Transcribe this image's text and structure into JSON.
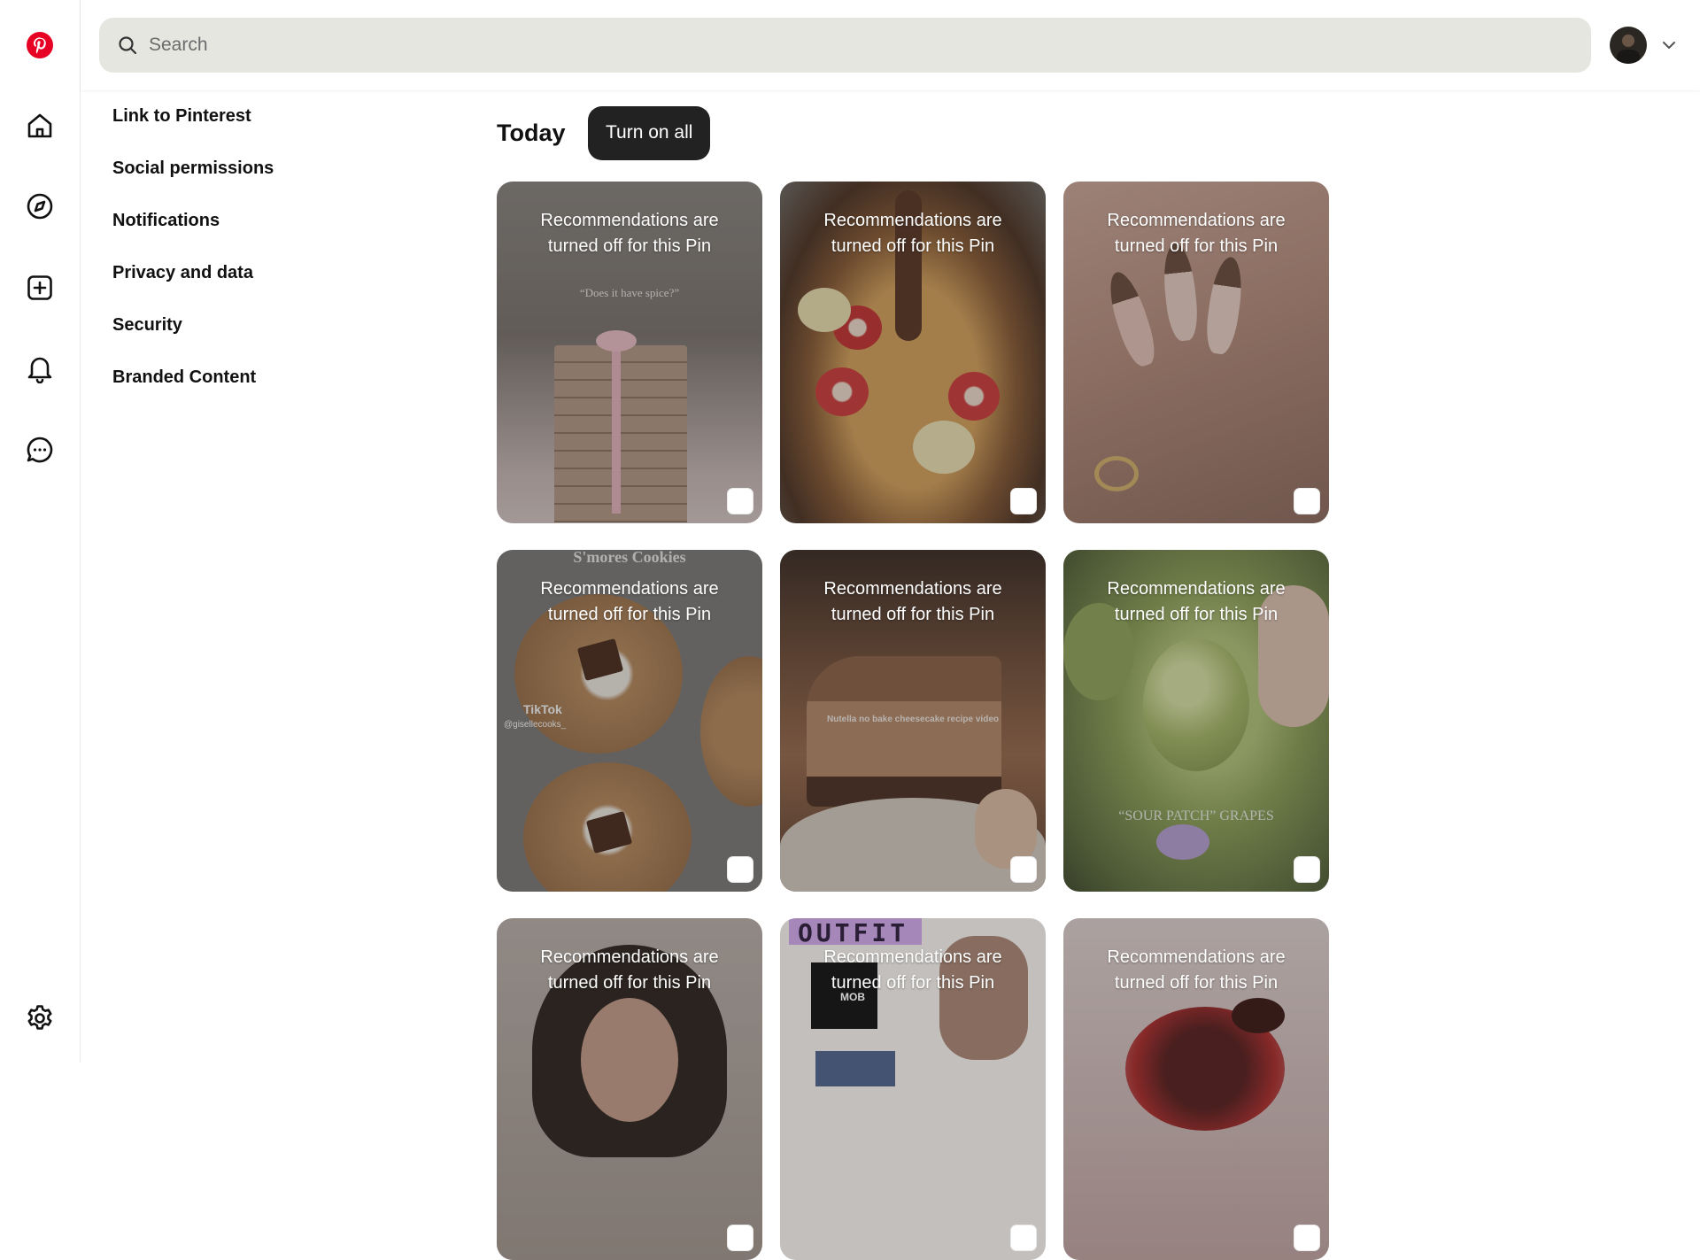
{
  "header": {
    "search_placeholder": "Search"
  },
  "rail": {
    "items": [
      "pinterest-logo",
      "home-icon",
      "explore-icon",
      "create-icon",
      "notifications-icon",
      "messages-icon",
      "settings-icon"
    ],
    "brand_color": "#e60023"
  },
  "settings_nav": {
    "items": [
      {
        "label": "Link to Pinterest"
      },
      {
        "label": "Social permissions"
      },
      {
        "label": "Notifications"
      },
      {
        "label": "Privacy and data"
      },
      {
        "label": "Security"
      },
      {
        "label": "Branded Content"
      }
    ]
  },
  "main": {
    "section_title": "Today",
    "turn_on_all_label": "Turn on all",
    "overlay_text": "Recommendations are turned off for this Pin",
    "pins": [
      {
        "caption": "“Does it have spice?”",
        "scene": "pink ribbon book stack"
      },
      {
        "caption": "",
        "scene": "fruit pasta bowl with chocolate drizzle"
      },
      {
        "caption": "",
        "scene": "almond nails with floral art"
      },
      {
        "caption": "S'mores Cookies",
        "watermark": "TikTok",
        "handle": "@gisellecooks_",
        "scene": "smores cookies"
      },
      {
        "caption": "Nutella no bake cheesecake recipe video",
        "scene": "nutella cheesecake slice"
      },
      {
        "caption": "“SOUR PATCH” GRAPES",
        "scene": "sugared green grapes"
      },
      {
        "caption": "",
        "scene": "portrait with curly hair"
      },
      {
        "caption": "OUTFIT",
        "subcaption": "MOB",
        "scene": "fashion outfit collage"
      },
      {
        "caption": "",
        "scene": "chocolate dipped strawberries"
      }
    ]
  },
  "colors": {
    "search_bg": "#e6e6e1",
    "button_bg": "#222222",
    "text": "#111111"
  }
}
